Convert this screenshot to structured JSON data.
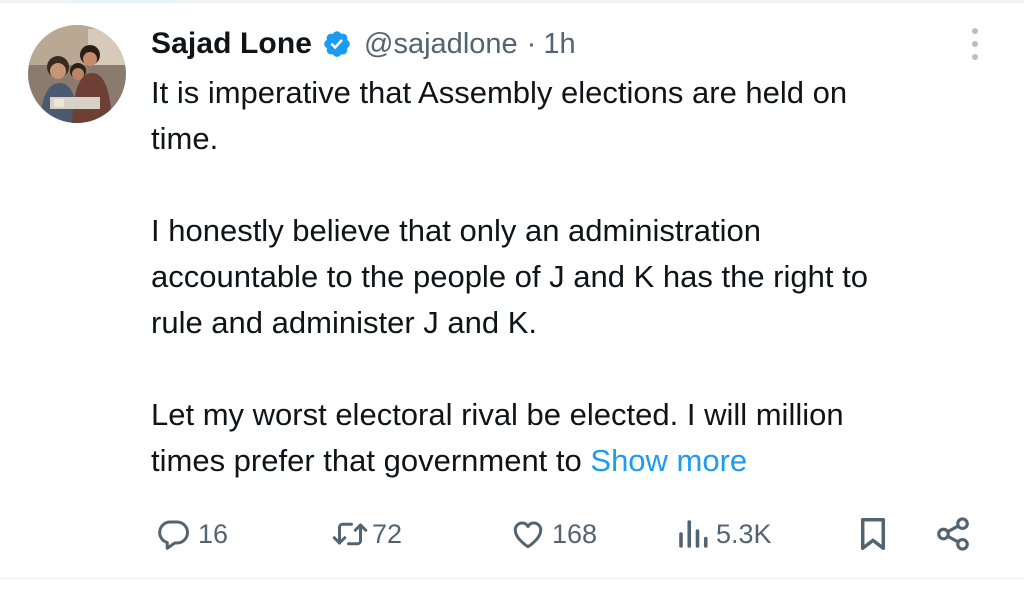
{
  "tweet": {
    "author": {
      "name": "Sajad Lone",
      "handle": "@sajadlone",
      "separator": "·",
      "time": "1h",
      "verified": true
    },
    "text": {
      "lines": [
        [
          "It is imperative that Assembly elections are held on",
          "time."
        ],
        [
          "I honestly believe that only an administration",
          "accountable to the people of J and K has the right to",
          "rule and administer J and K."
        ],
        [
          "Let my worst electoral rival be elected. I will million",
          "times prefer that government to"
        ]
      ],
      "show_more": "Show more"
    },
    "actions": {
      "replies": "16",
      "reposts": "72",
      "likes": "168",
      "views": "5.3K"
    },
    "colors": {
      "text": "#0f1419",
      "secondary": "#536471",
      "link": "#1d9bf0",
      "verified_badge": "#1d9bf0"
    },
    "icons": [
      "more-options-icon",
      "verified-badge-icon",
      "reply-icon",
      "repost-icon",
      "like-icon",
      "views-icon",
      "bookmark-icon",
      "share-icon"
    ]
  }
}
